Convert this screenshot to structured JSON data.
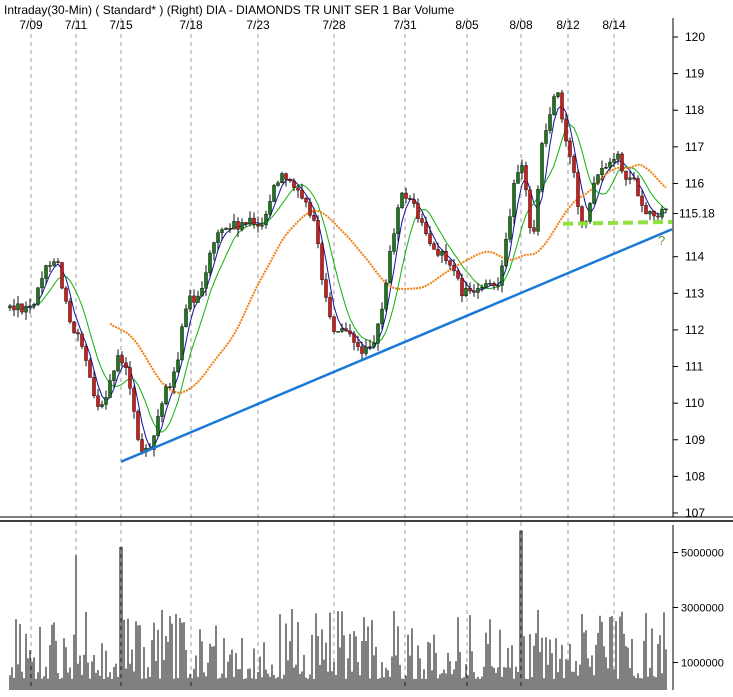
{
  "header": "Intraday(30-Min) ( Standard* )  (Right)  DIA - DIAMONDS TR UNIT SER 1  Bar  Volume",
  "colors": {
    "candle_up": "#1a7a1a",
    "candle_down": "#d81818",
    "wick": "#111111",
    "ma_fast": "#1010a0",
    "ma_mid": "#10b010",
    "ma_slow": "#f08010",
    "trendline": "#1a78d8",
    "support": "#90e040",
    "volume": "#000000",
    "grid": "#9a9a9a"
  },
  "chart_data": [
    {
      "type": "candlestick",
      "title": "Intraday(30-Min) ( Standard* )  (Right)  DIA - DIAMONDS TR UNIT SER 1  Bar  Volume",
      "x_tick_labels": [
        "7/09",
        "7/11",
        "7/15",
        "7/18",
        "7/23",
        "7/28",
        "7/31",
        "8/05",
        "8/08",
        "8/12",
        "8/14"
      ],
      "y_tick_labels": [
        "120",
        "119",
        "118",
        "117",
        "116",
        "115.18",
        "114",
        "113",
        "112",
        "111",
        "110",
        "109",
        "108",
        "107"
      ],
      "ylim": [
        107,
        120
      ],
      "last_price": 115.18,
      "grid": "vertical dashed at date ticks",
      "anchors": [
        {
          "date": "7/09",
          "price": 112.7
        },
        {
          "date": "7/09",
          "price": 114.0
        },
        {
          "date": "7/11",
          "price": 111.8
        },
        {
          "date": "7/11",
          "price": 110.0
        },
        {
          "date": "7/15",
          "price": 111.2
        },
        {
          "date": "7/15",
          "price": 108.6
        },
        {
          "date": "7/15",
          "price": 110.3
        },
        {
          "date": "7/18",
          "price": 112.8
        },
        {
          "date": "7/18",
          "price": 114.8
        },
        {
          "date": "7/23",
          "price": 114.9
        },
        {
          "date": "7/23",
          "price": 116.3
        },
        {
          "date": "7/23",
          "price": 115.3
        },
        {
          "date": "7/28",
          "price": 112.0
        },
        {
          "date": "7/28",
          "price": 111.4
        },
        {
          "date": "7/31",
          "price": 115.7
        },
        {
          "date": "7/31",
          "price": 114.2
        },
        {
          "date": "8/05",
          "price": 113.0
        },
        {
          "date": "8/05",
          "price": 113.2
        },
        {
          "date": "8/08",
          "price": 116.4
        },
        {
          "date": "8/08",
          "price": 114.7
        },
        {
          "date": "8/08",
          "price": 117.4
        },
        {
          "date": "8/08",
          "price": 118.5
        },
        {
          "date": "8/12",
          "price": 116.9
        },
        {
          "date": "8/12",
          "price": 115.0
        },
        {
          "date": "8/12",
          "price": 116.4
        },
        {
          "date": "8/14",
          "price": 116.8
        },
        {
          "date": "8/14",
          "price": 116.1
        },
        {
          "date": "8/14",
          "price": 115.2
        }
      ],
      "trendline": [
        {
          "date": "7/15",
          "price": 108.4
        },
        {
          "date": "8/14",
          "price": 114.8
        }
      ],
      "support_level": 114.9,
      "annotation": "?"
    },
    {
      "type": "bar",
      "title": "Volume",
      "y_tick_labels": [
        "5000000",
        "3000000",
        "1000000"
      ],
      "ylim": [
        0,
        6000000
      ],
      "spikes": [
        {
          "date": "7/11",
          "value": 4900000
        },
        {
          "date": "7/15",
          "value": 5200000
        },
        {
          "date": "8/08",
          "value": 5800000
        }
      ]
    }
  ]
}
